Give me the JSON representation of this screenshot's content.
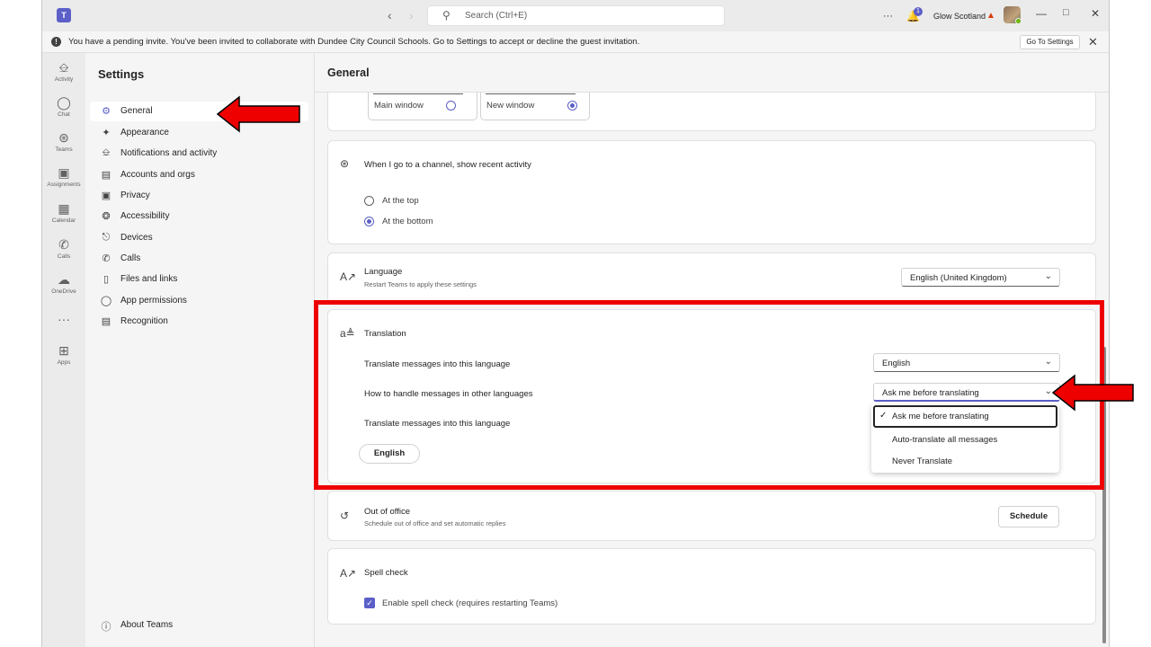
{
  "titlebar": {
    "search_placeholder": "Search (Ctrl+E)",
    "notification_count": "1",
    "org_name": "Glow Scotland",
    "more_label": "···"
  },
  "banner": {
    "message": "You have a pending invite. You've been invited to collaborate with Dundee City Council Schools. Go to Settings to accept or decline the guest invitation.",
    "button_label": "Go To Settings"
  },
  "rail": {
    "items": [
      {
        "label": "Activity",
        "icon": "bell-icon"
      },
      {
        "label": "Chat",
        "icon": "chat-icon"
      },
      {
        "label": "Teams",
        "icon": "teams-icon"
      },
      {
        "label": "Assignments",
        "icon": "backpack-icon"
      },
      {
        "label": "Calendar",
        "icon": "calendar-icon"
      },
      {
        "label": "Calls",
        "icon": "phone-icon"
      },
      {
        "label": "OneDrive",
        "icon": "cloud-icon"
      },
      {
        "label": "Apps",
        "icon": "plus-box-icon"
      }
    ],
    "more_label": "···"
  },
  "sidebar": {
    "title": "Settings",
    "items": [
      {
        "label": "General",
        "icon": "gear-icon",
        "active": true
      },
      {
        "label": "Appearance",
        "icon": "wand-icon"
      },
      {
        "label": "Notifications and activity",
        "icon": "bell-icon"
      },
      {
        "label": "Accounts and orgs",
        "icon": "id-card-icon"
      },
      {
        "label": "Privacy",
        "icon": "lock-icon"
      },
      {
        "label": "Accessibility",
        "icon": "accessibility-icon"
      },
      {
        "label": "Devices",
        "icon": "devices-icon"
      },
      {
        "label": "Calls",
        "icon": "phone-icon"
      },
      {
        "label": "Files and links",
        "icon": "file-icon"
      },
      {
        "label": "App permissions",
        "icon": "shield-icon"
      },
      {
        "label": "Recognition",
        "icon": "recognition-icon"
      }
    ],
    "about_label": "About Teams"
  },
  "content": {
    "title": "General",
    "window_options": [
      {
        "label": "Main window",
        "selected": false
      },
      {
        "label": "New window",
        "selected": true
      }
    ],
    "channel_activity": {
      "label": "When I go to a channel, show recent activity",
      "options": [
        {
          "label": "At the top",
          "selected": false
        },
        {
          "label": "At the bottom",
          "selected": true
        }
      ]
    },
    "language": {
      "label": "Language",
      "sub": "Restart Teams to apply these settings",
      "value": "English (United Kingdom)"
    },
    "translation": {
      "label": "Translation",
      "row1_label": "Translate messages into this language",
      "row1_value": "English",
      "row2_label": "How to handle messages in other languages",
      "row2_value": "Ask me before translating",
      "row3_label": "Translate messages into this language",
      "pill_label": "English",
      "menu_options": [
        "Ask me before translating",
        "Auto-translate all messages",
        "Never Translate"
      ],
      "menu_selected": 0
    },
    "out_of_office": {
      "label": "Out of office",
      "sub": "Schedule out of office and set automatic replies",
      "button": "Schedule"
    },
    "spell_check": {
      "label": "Spell check",
      "checkbox_label": "Enable spell check (requires restarting Teams)",
      "checked": true
    }
  },
  "colors": {
    "accent": "#5b5fc7",
    "annotation": "#ee0000"
  }
}
